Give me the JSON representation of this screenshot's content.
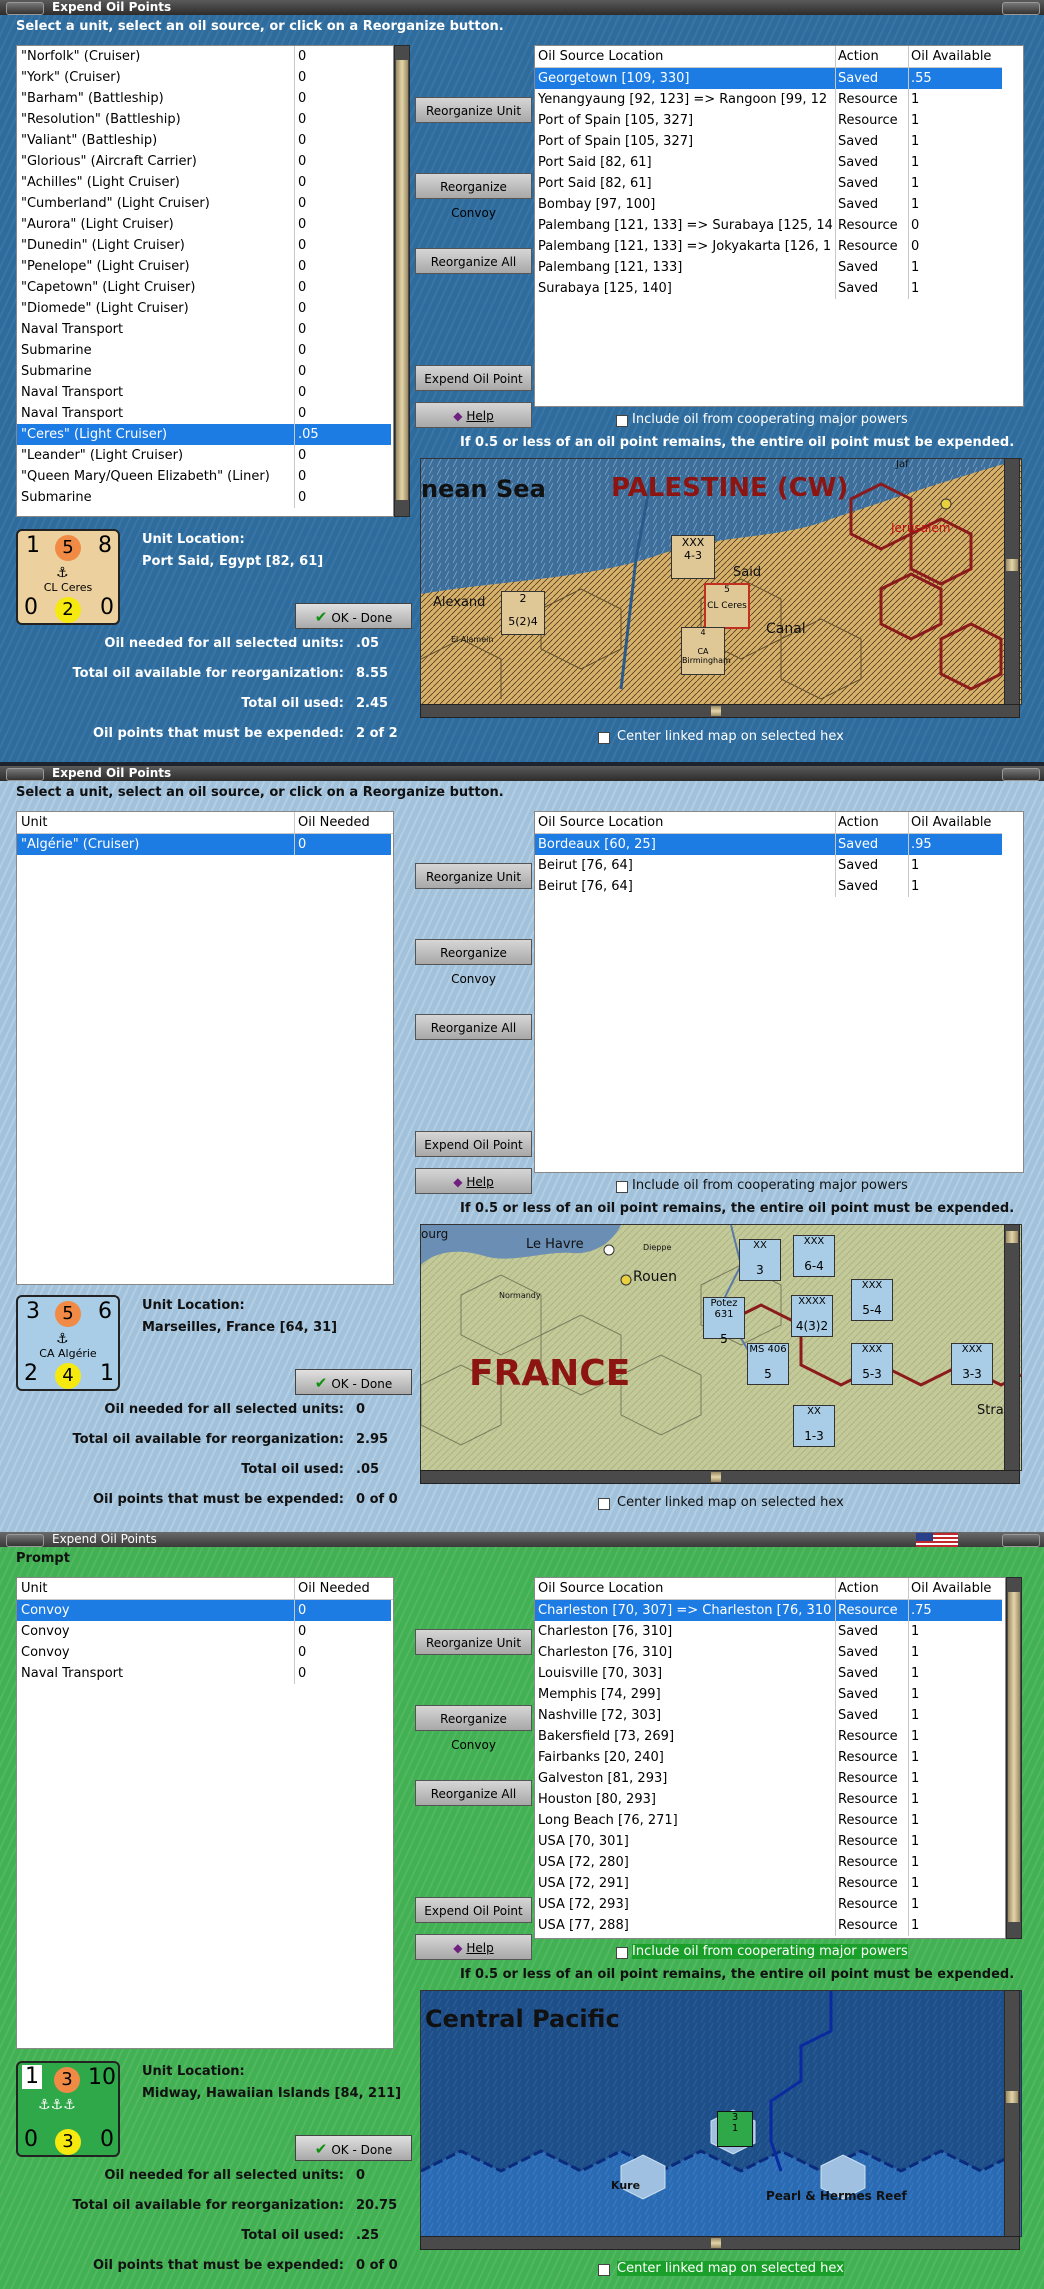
{
  "panel1": {
    "title": "Expend Oil Points",
    "instruction": "Select a unit, select an oil source, or click on a Reorganize button.",
    "units": [
      {
        "name": "\"Norfolk\" (Cruiser)",
        "oil": "0"
      },
      {
        "name": "\"York\" (Cruiser)",
        "oil": "0"
      },
      {
        "name": "\"Barham\" (Battleship)",
        "oil": "0"
      },
      {
        "name": "\"Resolution\" (Battleship)",
        "oil": "0"
      },
      {
        "name": "\"Valiant\" (Battleship)",
        "oil": "0"
      },
      {
        "name": "\"Glorious\" (Aircraft Carrier)",
        "oil": "0"
      },
      {
        "name": "\"Achilles\" (Light Cruiser)",
        "oil": "0"
      },
      {
        "name": "\"Cumberland\" (Light Cruiser)",
        "oil": "0"
      },
      {
        "name": "\"Aurora\" (Light Cruiser)",
        "oil": "0"
      },
      {
        "name": "\"Dunedin\" (Light Cruiser)",
        "oil": "0"
      },
      {
        "name": "\"Penelope\" (Light Cruiser)",
        "oil": "0"
      },
      {
        "name": "\"Capetown\" (Light Cruiser)",
        "oil": "0"
      },
      {
        "name": "\"Diomede\" (Light Cruiser)",
        "oil": "0"
      },
      {
        "name": "Naval Transport",
        "oil": "0"
      },
      {
        "name": "Submarine",
        "oil": "0"
      },
      {
        "name": "Submarine",
        "oil": "0"
      },
      {
        "name": "Naval Transport",
        "oil": "0"
      },
      {
        "name": "Naval Transport",
        "oil": "0"
      },
      {
        "name": "\"Ceres\" (Light Cruiser)",
        "oil": ".05"
      },
      {
        "name": "\"Leander\" (Light Cruiser)",
        "oil": "0"
      },
      {
        "name": "\"Queen Mary/Queen Elizabeth\" (Liner)",
        "oil": "0"
      },
      {
        "name": "Submarine",
        "oil": "0"
      }
    ],
    "selected_unit": 18,
    "oil_headers": {
      "location": "Oil Source Location",
      "action": "Action",
      "available": "Oil Available"
    },
    "oil_sources": [
      {
        "location": "Georgetown [109, 330]",
        "action": "Saved",
        "available": ".55"
      },
      {
        "location": "Yenangyaung [92, 123] => Rangoon [99, 12",
        "action": "Resource",
        "available": "1"
      },
      {
        "location": "Port of Spain [105, 327]",
        "action": "Resource",
        "available": "1"
      },
      {
        "location": "Port of Spain [105, 327]",
        "action": "Saved",
        "available": "1"
      },
      {
        "location": "Port Said [82, 61]",
        "action": "Saved",
        "available": "1"
      },
      {
        "location": "Port Said [82, 61]",
        "action": "Saved",
        "available": "1"
      },
      {
        "location": "Bombay [97, 100]",
        "action": "Saved",
        "available": "1"
      },
      {
        "location": "Palembang [121, 133] => Surabaya [125, 14",
        "action": "Resource",
        "available": "0"
      },
      {
        "location": "Palembang [121, 133] => Jokyakarta [126, 1",
        "action": "Resource",
        "available": "0"
      },
      {
        "location": "Palembang [121, 133]",
        "action": "Saved",
        "available": "1"
      },
      {
        "location": "Surabaya [125, 140]",
        "action": "Saved",
        "available": "1"
      }
    ],
    "selected_source": 0,
    "buttons": {
      "reorg_unit": "Reorganize Unit",
      "reorg_convoy": "Reorganize Convoy",
      "reorg_all": "Reorganize All",
      "expend": "Expend Oil Point",
      "help": "Help",
      "ok": "OK - Done"
    },
    "include_oil_label": "Include oil from cooperating major powers",
    "rule_text": "If 0.5 or less of an oil point remains, the entire oil point must be expended.",
    "counter": {
      "top_left": "1",
      "top_mid": "5",
      "top_right": "8",
      "name": "CL Ceres",
      "bot_left": "0",
      "bot_mid": "2",
      "bot_right": "0"
    },
    "unit_location_label": "Unit Location:",
    "unit_location": "Port Said, Egypt [82, 61]",
    "stats": [
      {
        "label": "Oil needed for all selected units:",
        "value": ".05"
      },
      {
        "label": "Total oil available for reorganization:",
        "value": "8.55"
      },
      {
        "label": "Total oil used:",
        "value": "2.45"
      },
      {
        "label": "Oil points that must be expended:",
        "value": "2 of 2"
      }
    ],
    "map_labels": {
      "sea": "nean Sea",
      "region": "PALESTINE (CW)",
      "city1": "Jerusalem",
      "city2": "Said",
      "city3": "Alexand",
      "city4": "El Alamein",
      "canal": "Canal",
      "top": "Jaf"
    },
    "map_units": [
      {
        "top": "XXX",
        "value": "4-3"
      },
      {
        "top": "2",
        "value": "5(2)4"
      },
      {
        "top": "5",
        "value": "CL Ceres"
      },
      {
        "top": "4",
        "value": "CA Birmingham"
      }
    ],
    "center_label": "Center linked map on selected hex"
  },
  "panel2": {
    "title": "Expend Oil Points",
    "instruction": "Select a unit, select an oil source, or click on a Reorganize button.",
    "unit_headers": {
      "unit": "Unit",
      "oil": "Oil Needed"
    },
    "units": [
      {
        "name": "\"Algérie\" (Cruiser)",
        "oil": "0"
      }
    ],
    "selected_unit": 0,
    "oil_headers": {
      "location": "Oil Source Location",
      "action": "Action",
      "available": "Oil Available"
    },
    "oil_sources": [
      {
        "location": "Bordeaux [60, 25]",
        "action": "Saved",
        "available": ".95"
      },
      {
        "location": "Beirut [76, 64]",
        "action": "Saved",
        "available": "1"
      },
      {
        "location": "Beirut [76, 64]",
        "action": "Saved",
        "available": "1"
      }
    ],
    "selected_source": 0,
    "buttons": {
      "reorg_unit": "Reorganize Unit",
      "reorg_convoy": "Reorganize Convoy",
      "reorg_all": "Reorganize All",
      "expend": "Expend Oil Point",
      "help": "Help",
      "ok": "OK - Done"
    },
    "include_oil_label": "Include oil from cooperating major powers",
    "rule_text": "If 0.5 or less of an oil point remains, the entire oil point must be expended.",
    "counter": {
      "top_left": "3",
      "top_mid": "5",
      "top_right": "6",
      "name": "CA Algérie",
      "bot_left": "2",
      "bot_mid": "4",
      "bot_right": "1"
    },
    "unit_location_label": "Unit Location:",
    "unit_location": "Marseilles, France [64, 31]",
    "stats": [
      {
        "label": "Oil needed for all selected units:",
        "value": "0"
      },
      {
        "label": "Total oil available for reorganization:",
        "value": "2.95"
      },
      {
        "label": "Total oil used:",
        "value": ".05"
      },
      {
        "label": "Oil points that must be expended:",
        "value": "0 of 0"
      }
    ],
    "map_labels": {
      "region": "FRANCE",
      "city1": "Le Havre",
      "city2": "Rouen",
      "city3": "Dieppe",
      "city4": "Normandy",
      "city5": "Strasb",
      "top": "ourg"
    },
    "map_units": [
      {
        "top": "XX",
        "value": "3"
      },
      {
        "top": "XXX",
        "value": "6-4"
      },
      {
        "top": "XXX",
        "value": "5-4"
      },
      {
        "top": "XXX",
        "value": "5-3"
      },
      {
        "top": "XXX",
        "value": "3-3"
      },
      {
        "top": "XXXX",
        "value": "4(3)2"
      },
      {
        "top": "XX",
        "value": "1-3"
      },
      {
        "top": "Potez 631",
        "value": "5"
      },
      {
        "top": "MS 406",
        "value": "5"
      }
    ],
    "center_label": "Center linked map on selected hex"
  },
  "panel3": {
    "title": "Expend Oil Points",
    "instruction": "Prompt",
    "unit_headers": {
      "unit": "Unit",
      "oil": "Oil Needed"
    },
    "units": [
      {
        "name": "Convoy",
        "oil": "0"
      },
      {
        "name": "Convoy",
        "oil": "0"
      },
      {
        "name": "Convoy",
        "oil": "0"
      },
      {
        "name": "Naval Transport",
        "oil": "0"
      }
    ],
    "selected_unit": 0,
    "oil_headers": {
      "location": "Oil Source Location",
      "action": "Action",
      "available": "Oil Available"
    },
    "oil_sources": [
      {
        "location": "Charleston [70, 307] => Charleston [76, 310",
        "action": "Resource",
        "available": ".75"
      },
      {
        "location": "Charleston [76, 310]",
        "action": "Saved",
        "available": "1"
      },
      {
        "location": "Charleston [76, 310]",
        "action": "Saved",
        "available": "1"
      },
      {
        "location": "Louisville [70, 303]",
        "action": "Saved",
        "available": "1"
      },
      {
        "location": "Memphis [74, 299]",
        "action": "Saved",
        "available": "1"
      },
      {
        "location": "Nashville [72, 303]",
        "action": "Saved",
        "available": "1"
      },
      {
        "location": "Bakersfield [73, 269]",
        "action": "Resource",
        "available": "1"
      },
      {
        "location": "Fairbanks [20, 240]",
        "action": "Resource",
        "available": "1"
      },
      {
        "location": "Galveston [81, 293]",
        "action": "Resource",
        "available": "1"
      },
      {
        "location": "Houston [80, 293]",
        "action": "Resource",
        "available": "1"
      },
      {
        "location": "Long Beach [76, 271]",
        "action": "Resource",
        "available": "1"
      },
      {
        "location": "USA [70, 301]",
        "action": "Resource",
        "available": "1"
      },
      {
        "location": "USA [72, 280]",
        "action": "Resource",
        "available": "1"
      },
      {
        "location": "USA [72, 291]",
        "action": "Resource",
        "available": "1"
      },
      {
        "location": "USA [72, 293]",
        "action": "Resource",
        "available": "1"
      },
      {
        "location": "USA [77, 288]",
        "action": "Resource",
        "available": "1"
      }
    ],
    "selected_source": 0,
    "buttons": {
      "reorg_unit": "Reorganize Unit",
      "reorg_convoy": "Reorganize Convoy",
      "reorg_all": "Reorganize All",
      "expend": "Expend Oil Point",
      "help": "Help",
      "ok": "OK - Done"
    },
    "include_oil_label": "Include oil from cooperating major powers",
    "rule_text": "If 0.5 or less of an oil point remains, the entire oil point must be expended.",
    "counter": {
      "top_left": "1",
      "top_mid": "3",
      "top_right": "10",
      "bot_left": "0",
      "bot_mid": "3",
      "bot_right": "0"
    },
    "unit_location_label": "Unit Location:",
    "unit_location": "Midway, Hawaiian Islands [84, 211]",
    "stats": [
      {
        "label": "Oil needed for all selected units:",
        "value": "0"
      },
      {
        "label": "Total oil available for reorganization:",
        "value": "20.75"
      },
      {
        "label": "Total oil used:",
        "value": ".25"
      },
      {
        "label": "Oil points that must be expended:",
        "value": "0 of 0"
      }
    ],
    "map_labels": {
      "region": "Central Pacific",
      "city1": "Kure",
      "city2": "Pearl & Hermes Reef"
    },
    "map_units": [
      {
        "top": "3",
        "value": "1"
      }
    ],
    "center_label": "Center linked map on selected hex"
  },
  "colors": {
    "selection": "#1c7ce4",
    "panel1_bg": "#2e6c9e",
    "panel2_bg": "#9ebfda",
    "panel3_bg": "#42b153",
    "counter1": "#ecd19e",
    "counter2": "#a9cde6",
    "counter3": "#2fa84a",
    "circle_orange": "#f08a44",
    "circle_yellow": "#f5e90f"
  }
}
